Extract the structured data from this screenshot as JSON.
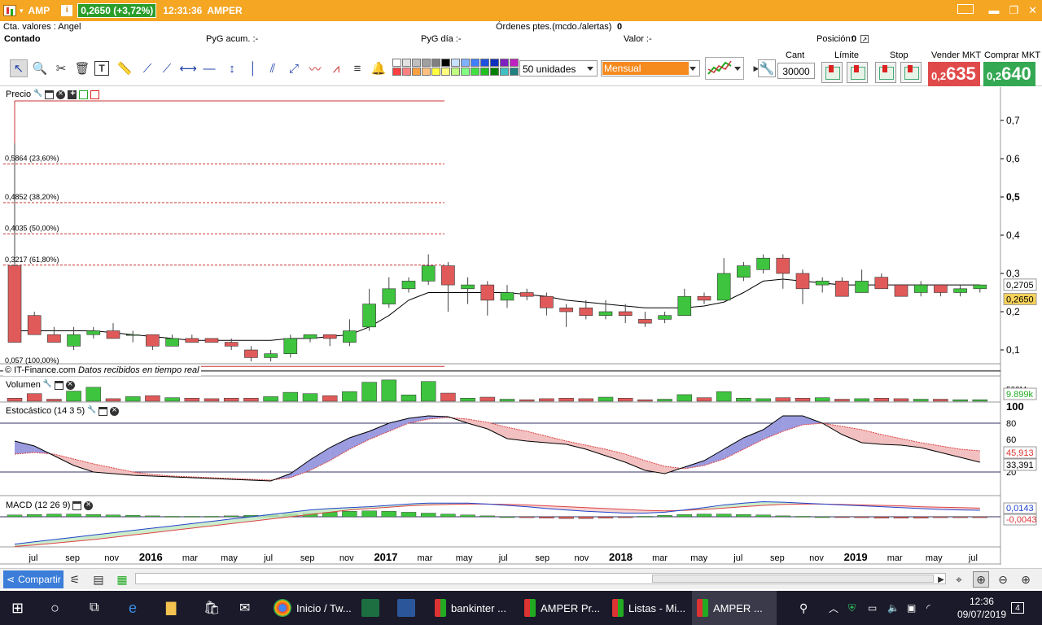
{
  "window": {
    "symbol": "AMP",
    "quote": "0,2650 (+3,72%)",
    "time": "12:31:36",
    "name": "AMPER",
    "info_glyph": "i"
  },
  "account": {
    "cta": "Cta. valores : Angel",
    "ordenes_label": "Órdenes ptes.(mcdo./alertas)",
    "ordenes_value": "0",
    "contado": "Contado",
    "pyg_acum": "PyG acum. :-",
    "pyg_dia": "PyG día :-",
    "valor": "Valor :-",
    "posicion_label": "Posición:",
    "posicion_value": "0"
  },
  "toolbar": {
    "units": "50 unidades",
    "period": "Mensual",
    "cant_label": "Cant",
    "cant_value": "30000",
    "limite_label": "Límite",
    "stop_label": "Stop",
    "sell_label": "Vender MKT",
    "sell_prefix": "0,2",
    "sell_big": "635",
    "buy_label": "Comprar MKT",
    "buy_prefix": "0,2",
    "buy_big": "640",
    "swatch_colors": [
      "#ffffff",
      "#e0e0e0",
      "#c0c0c0",
      "#a0a0a0",
      "#808080",
      "#000000",
      "#c8e0ff",
      "#80b0ff",
      "#4080ff",
      "#2050e0",
      "#1030c0",
      "#8020c0",
      "#c020c0",
      "#ff4040",
      "#ff8080",
      "#ffa040",
      "#ffc080",
      "#ffff40",
      "#ffff80",
      "#c0ff80",
      "#80ff80",
      "#40e040",
      "#20c020",
      "#008000",
      "#40c0c0",
      "#208080"
    ]
  },
  "chart": {
    "price_title": "Precio",
    "copyright": "© IT-Finance.com",
    "realtime": "Datos recibidos en tiempo real",
    "volume_title": "Volumen",
    "stoch_title": "Estocástico (14 3 5)",
    "macd_title": "MACD (12 26 9)",
    "fib_levels": [
      {
        "label": "0,5864 (23,60%)",
        "price": 0.5864
      },
      {
        "label": "0,4852 (38,20%)",
        "price": 0.4852
      },
      {
        "label": "0,4035 (50,00%)",
        "price": 0.4035
      },
      {
        "label": "0,3217 (61,80%)",
        "price": 0.3217
      },
      {
        "label": "0,057 (100,00%)",
        "price": 0.057
      }
    ],
    "price_axis": [
      {
        "label": "0,7",
        "v": 0.7
      },
      {
        "label": "0,6",
        "v": 0.6
      },
      {
        "label": "0,5",
        "v": 0.5
      },
      {
        "label": "0,4",
        "v": 0.4
      },
      {
        "label": "0,3",
        "v": 0.3
      },
      {
        "label": "0,2",
        "v": 0.2
      },
      {
        "label": "0,1",
        "v": 0.1
      }
    ],
    "price_tag_hi": "0,2705",
    "price_tag_last": "0,2650",
    "volume_axis": "500M",
    "volume_tag": "9.899k",
    "stoch_axis": [
      "100",
      "80",
      "60",
      "40",
      "20"
    ],
    "stoch_tag1": "45,913",
    "stoch_tag2": "33,391",
    "macd_tag1": "0,0143",
    "macd_tag2": "-0,0043",
    "x_labels": [
      "jul",
      "sep",
      "nov",
      "2016",
      "mar",
      "may",
      "jul",
      "sep",
      "nov",
      "2017",
      "mar",
      "may",
      "jul",
      "sep",
      "nov",
      "2018",
      "mar",
      "may",
      "jul",
      "sep",
      "nov",
      "2019",
      "mar",
      "may",
      "jul"
    ]
  },
  "chart_data": {
    "type": "candlestick",
    "periodicity": "Mensual",
    "candles": [
      {
        "o": 0.32,
        "h": 0.64,
        "l": 0.14,
        "c": 0.12
      },
      {
        "o": 0.19,
        "h": 0.2,
        "l": 0.15,
        "c": 0.14
      },
      {
        "o": 0.14,
        "h": 0.16,
        "l": 0.12,
        "c": 0.12
      },
      {
        "o": 0.11,
        "h": 0.16,
        "l": 0.1,
        "c": 0.14
      },
      {
        "o": 0.14,
        "h": 0.16,
        "l": 0.13,
        "c": 0.15
      },
      {
        "o": 0.15,
        "h": 0.17,
        "l": 0.13,
        "c": 0.13
      },
      {
        "o": 0.14,
        "h": 0.15,
        "l": 0.12,
        "c": 0.14
      },
      {
        "o": 0.14,
        "h": 0.14,
        "l": 0.1,
        "c": 0.11
      },
      {
        "o": 0.11,
        "h": 0.14,
        "l": 0.11,
        "c": 0.13
      },
      {
        "o": 0.13,
        "h": 0.14,
        "l": 0.12,
        "c": 0.12
      },
      {
        "o": 0.13,
        "h": 0.13,
        "l": 0.12,
        "c": 0.12
      },
      {
        "o": 0.12,
        "h": 0.13,
        "l": 0.1,
        "c": 0.11
      },
      {
        "o": 0.1,
        "h": 0.11,
        "l": 0.07,
        "c": 0.08
      },
      {
        "o": 0.08,
        "h": 0.1,
        "l": 0.07,
        "c": 0.09
      },
      {
        "o": 0.09,
        "h": 0.14,
        "l": 0.08,
        "c": 0.13
      },
      {
        "o": 0.13,
        "h": 0.14,
        "l": 0.12,
        "c": 0.14
      },
      {
        "o": 0.14,
        "h": 0.14,
        "l": 0.11,
        "c": 0.13
      },
      {
        "o": 0.12,
        "h": 0.18,
        "l": 0.11,
        "c": 0.15
      },
      {
        "o": 0.16,
        "h": 0.26,
        "l": 0.15,
        "c": 0.22
      },
      {
        "o": 0.22,
        "h": 0.29,
        "l": 0.21,
        "c": 0.26
      },
      {
        "o": 0.26,
        "h": 0.29,
        "l": 0.25,
        "c": 0.28
      },
      {
        "o": 0.28,
        "h": 0.35,
        "l": 0.27,
        "c": 0.32
      },
      {
        "o": 0.32,
        "h": 0.33,
        "l": 0.2,
        "c": 0.27
      },
      {
        "o": 0.26,
        "h": 0.29,
        "l": 0.22,
        "c": 0.27
      },
      {
        "o": 0.27,
        "h": 0.28,
        "l": 0.19,
        "c": 0.23
      },
      {
        "o": 0.23,
        "h": 0.27,
        "l": 0.21,
        "c": 0.25
      },
      {
        "o": 0.25,
        "h": 0.26,
        "l": 0.23,
        "c": 0.24
      },
      {
        "o": 0.24,
        "h": 0.25,
        "l": 0.19,
        "c": 0.21
      },
      {
        "o": 0.21,
        "h": 0.22,
        "l": 0.16,
        "c": 0.2
      },
      {
        "o": 0.21,
        "h": 0.23,
        "l": 0.18,
        "c": 0.19
      },
      {
        "o": 0.19,
        "h": 0.23,
        "l": 0.18,
        "c": 0.2
      },
      {
        "o": 0.2,
        "h": 0.22,
        "l": 0.17,
        "c": 0.19
      },
      {
        "o": 0.18,
        "h": 0.2,
        "l": 0.16,
        "c": 0.17
      },
      {
        "o": 0.18,
        "h": 0.2,
        "l": 0.17,
        "c": 0.19
      },
      {
        "o": 0.19,
        "h": 0.26,
        "l": 0.19,
        "c": 0.24
      },
      {
        "o": 0.24,
        "h": 0.25,
        "l": 0.22,
        "c": 0.23
      },
      {
        "o": 0.23,
        "h": 0.34,
        "l": 0.23,
        "c": 0.3
      },
      {
        "o": 0.29,
        "h": 0.33,
        "l": 0.28,
        "c": 0.32
      },
      {
        "o": 0.31,
        "h": 0.35,
        "l": 0.3,
        "c": 0.34
      },
      {
        "o": 0.34,
        "h": 0.35,
        "l": 0.26,
        "c": 0.3
      },
      {
        "o": 0.3,
        "h": 0.31,
        "l": 0.22,
        "c": 0.26
      },
      {
        "o": 0.27,
        "h": 0.29,
        "l": 0.25,
        "c": 0.28
      },
      {
        "o": 0.28,
        "h": 0.29,
        "l": 0.24,
        "c": 0.24
      },
      {
        "o": 0.25,
        "h": 0.31,
        "l": 0.25,
        "c": 0.28
      },
      {
        "o": 0.29,
        "h": 0.3,
        "l": 0.26,
        "c": 0.26
      },
      {
        "o": 0.27,
        "h": 0.27,
        "l": 0.24,
        "c": 0.24
      },
      {
        "o": 0.25,
        "h": 0.28,
        "l": 0.24,
        "c": 0.27
      },
      {
        "o": 0.27,
        "h": 0.27,
        "l": 0.24,
        "c": 0.25
      },
      {
        "o": 0.25,
        "h": 0.27,
        "l": 0.24,
        "c": 0.26
      },
      {
        "o": 0.26,
        "h": 0.27,
        "l": 0.25,
        "c": 0.27
      }
    ],
    "moving_average": [
      0.15,
      0.15,
      0.15,
      0.15,
      0.15,
      0.145,
      0.14,
      0.135,
      0.13,
      0.125,
      0.125,
      0.125,
      0.125,
      0.125,
      0.13,
      0.13,
      0.135,
      0.14,
      0.16,
      0.19,
      0.23,
      0.25,
      0.25,
      0.25,
      0.25,
      0.25,
      0.245,
      0.24,
      0.23,
      0.225,
      0.22,
      0.215,
      0.21,
      0.21,
      0.21,
      0.215,
      0.225,
      0.25,
      0.28,
      0.285,
      0.28,
      0.275,
      0.27,
      0.27,
      0.27,
      0.27,
      0.27,
      0.27,
      0.27,
      0.27
    ],
    "volume": [
      12,
      30,
      8,
      40,
      55,
      10,
      18,
      22,
      14,
      12,
      10,
      12,
      12,
      18,
      35,
      30,
      22,
      38,
      75,
      84,
      25,
      78,
      32,
      12,
      16,
      8,
      6,
      10,
      12,
      10,
      16,
      12,
      6,
      8,
      26,
      14,
      38,
      12,
      10,
      14,
      12,
      14,
      8,
      10,
      12,
      10,
      8,
      8,
      6,
      6
    ],
    "stochastic_k": [
      58,
      52,
      40,
      28,
      20,
      18,
      16,
      15,
      14,
      13,
      12,
      11,
      10,
      9,
      18,
      35,
      50,
      62,
      70,
      80,
      86,
      89,
      88,
      80,
      73,
      61,
      58,
      56,
      54,
      48,
      40,
      32,
      22,
      18,
      26,
      34,
      48,
      62,
      72,
      89,
      89,
      80,
      66,
      56,
      54,
      53,
      50,
      44,
      38,
      32
    ],
    "stochastic_d": [
      42,
      44,
      42,
      36,
      30,
      25,
      20,
      17,
      15,
      14,
      13,
      12,
      11,
      10,
      13,
      22,
      34,
      48,
      60,
      70,
      80,
      85,
      87,
      85,
      81,
      75,
      70,
      64,
      58,
      53,
      48,
      42,
      34,
      27,
      24,
      28,
      36,
      48,
      60,
      70,
      78,
      80,
      76,
      72,
      66,
      61,
      56,
      52,
      48,
      46
    ],
    "macd_hist": [
      0.004,
      0.005,
      0.006,
      0.006,
      0.005,
      0.004,
      0.003,
      0.002,
      0.001,
      0.001,
      0.001,
      0.002,
      0.003,
      0.004,
      0.006,
      0.008,
      0.01,
      0.012,
      0.013,
      0.012,
      0.01,
      0.008,
      0.006,
      0.004,
      0.002,
      0.0,
      -0.002,
      -0.003,
      -0.004,
      -0.004,
      -0.003,
      -0.002,
      0.001,
      0.003,
      0.005,
      0.006,
      0.006,
      0.005,
      0.004,
      0.002,
      0.001,
      0.0,
      -0.001,
      -0.002,
      -0.003,
      -0.003,
      -0.003,
      -0.002,
      -0.002,
      -0.002
    ],
    "macd_line": [
      -0.06,
      -0.055,
      -0.05,
      -0.045,
      -0.04,
      -0.035,
      -0.03,
      -0.025,
      -0.02,
      -0.015,
      -0.01,
      -0.005,
      0.0,
      0.005,
      0.01,
      0.015,
      0.018,
      0.02,
      0.022,
      0.025,
      0.028,
      0.03,
      0.03,
      0.03,
      0.028,
      0.025,
      0.022,
      0.018,
      0.015,
      0.012,
      0.01,
      0.008,
      0.008,
      0.01,
      0.015,
      0.02,
      0.026,
      0.03,
      0.033,
      0.032,
      0.03,
      0.028,
      0.026,
      0.024,
      0.022,
      0.02,
      0.018,
      0.016,
      0.015,
      0.0143
    ],
    "macd_signal": [
      -0.065,
      -0.062,
      -0.058,
      -0.054,
      -0.05,
      -0.045,
      -0.04,
      -0.035,
      -0.03,
      -0.025,
      -0.02,
      -0.015,
      -0.01,
      -0.005,
      0.0,
      0.005,
      0.01,
      0.015,
      0.018,
      0.021,
      0.024,
      0.026,
      0.027,
      0.028,
      0.028,
      0.027,
      0.026,
      0.024,
      0.022,
      0.02,
      0.018,
      0.016,
      0.014,
      0.013,
      0.014,
      0.016,
      0.019,
      0.022,
      0.025,
      0.027,
      0.028,
      0.028,
      0.027,
      0.026,
      0.025,
      0.024,
      0.022,
      0.021,
      0.02,
      0.019
    ]
  },
  "bottom": {
    "share": "Compartir"
  },
  "taskbar": {
    "items": [
      {
        "label": "Inicio / Tw..."
      },
      {
        "label": "bankinter ..."
      },
      {
        "label": "AMPER Pr..."
      },
      {
        "label": "Listas - Mi..."
      },
      {
        "label": "AMPER ..."
      }
    ],
    "clock_time": "12:36",
    "clock_date": "09/07/2019",
    "notif_count": "4"
  }
}
